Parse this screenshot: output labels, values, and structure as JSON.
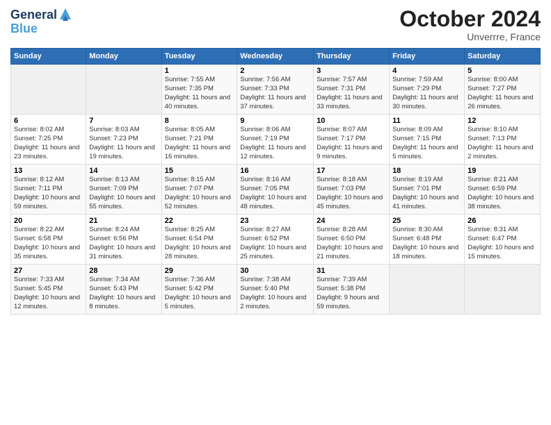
{
  "header": {
    "logo_line1": "General",
    "logo_line2": "Blue",
    "month_title": "October 2024",
    "location": "Unverrre, France"
  },
  "weekdays": [
    "Sunday",
    "Monday",
    "Tuesday",
    "Wednesday",
    "Thursday",
    "Friday",
    "Saturday"
  ],
  "weeks": [
    [
      {
        "day": "",
        "sunrise": "",
        "sunset": "",
        "daylight": ""
      },
      {
        "day": "",
        "sunrise": "",
        "sunset": "",
        "daylight": ""
      },
      {
        "day": "1",
        "sunrise": "Sunrise: 7:55 AM",
        "sunset": "Sunset: 7:35 PM",
        "daylight": "Daylight: 11 hours and 40 minutes."
      },
      {
        "day": "2",
        "sunrise": "Sunrise: 7:56 AM",
        "sunset": "Sunset: 7:33 PM",
        "daylight": "Daylight: 11 hours and 37 minutes."
      },
      {
        "day": "3",
        "sunrise": "Sunrise: 7:57 AM",
        "sunset": "Sunset: 7:31 PM",
        "daylight": "Daylight: 11 hours and 33 minutes."
      },
      {
        "day": "4",
        "sunrise": "Sunrise: 7:59 AM",
        "sunset": "Sunset: 7:29 PM",
        "daylight": "Daylight: 11 hours and 30 minutes."
      },
      {
        "day": "5",
        "sunrise": "Sunrise: 8:00 AM",
        "sunset": "Sunset: 7:27 PM",
        "daylight": "Daylight: 11 hours and 26 minutes."
      }
    ],
    [
      {
        "day": "6",
        "sunrise": "Sunrise: 8:02 AM",
        "sunset": "Sunset: 7:25 PM",
        "daylight": "Daylight: 11 hours and 23 minutes."
      },
      {
        "day": "7",
        "sunrise": "Sunrise: 8:03 AM",
        "sunset": "Sunset: 7:23 PM",
        "daylight": "Daylight: 11 hours and 19 minutes."
      },
      {
        "day": "8",
        "sunrise": "Sunrise: 8:05 AM",
        "sunset": "Sunset: 7:21 PM",
        "daylight": "Daylight: 11 hours and 16 minutes."
      },
      {
        "day": "9",
        "sunrise": "Sunrise: 8:06 AM",
        "sunset": "Sunset: 7:19 PM",
        "daylight": "Daylight: 11 hours and 12 minutes."
      },
      {
        "day": "10",
        "sunrise": "Sunrise: 8:07 AM",
        "sunset": "Sunset: 7:17 PM",
        "daylight": "Daylight: 11 hours and 9 minutes."
      },
      {
        "day": "11",
        "sunrise": "Sunrise: 8:09 AM",
        "sunset": "Sunset: 7:15 PM",
        "daylight": "Daylight: 11 hours and 5 minutes."
      },
      {
        "day": "12",
        "sunrise": "Sunrise: 8:10 AM",
        "sunset": "Sunset: 7:13 PM",
        "daylight": "Daylight: 11 hours and 2 minutes."
      }
    ],
    [
      {
        "day": "13",
        "sunrise": "Sunrise: 8:12 AM",
        "sunset": "Sunset: 7:11 PM",
        "daylight": "Daylight: 10 hours and 59 minutes."
      },
      {
        "day": "14",
        "sunrise": "Sunrise: 8:13 AM",
        "sunset": "Sunset: 7:09 PM",
        "daylight": "Daylight: 10 hours and 55 minutes."
      },
      {
        "day": "15",
        "sunrise": "Sunrise: 8:15 AM",
        "sunset": "Sunset: 7:07 PM",
        "daylight": "Daylight: 10 hours and 52 minutes."
      },
      {
        "day": "16",
        "sunrise": "Sunrise: 8:16 AM",
        "sunset": "Sunset: 7:05 PM",
        "daylight": "Daylight: 10 hours and 48 minutes."
      },
      {
        "day": "17",
        "sunrise": "Sunrise: 8:18 AM",
        "sunset": "Sunset: 7:03 PM",
        "daylight": "Daylight: 10 hours and 45 minutes."
      },
      {
        "day": "18",
        "sunrise": "Sunrise: 8:19 AM",
        "sunset": "Sunset: 7:01 PM",
        "daylight": "Daylight: 10 hours and 41 minutes."
      },
      {
        "day": "19",
        "sunrise": "Sunrise: 8:21 AM",
        "sunset": "Sunset: 6:59 PM",
        "daylight": "Daylight: 10 hours and 38 minutes."
      }
    ],
    [
      {
        "day": "20",
        "sunrise": "Sunrise: 8:22 AM",
        "sunset": "Sunset: 6:58 PM",
        "daylight": "Daylight: 10 hours and 35 minutes."
      },
      {
        "day": "21",
        "sunrise": "Sunrise: 8:24 AM",
        "sunset": "Sunset: 6:56 PM",
        "daylight": "Daylight: 10 hours and 31 minutes."
      },
      {
        "day": "22",
        "sunrise": "Sunrise: 8:25 AM",
        "sunset": "Sunset: 6:54 PM",
        "daylight": "Daylight: 10 hours and 28 minutes."
      },
      {
        "day": "23",
        "sunrise": "Sunrise: 8:27 AM",
        "sunset": "Sunset: 6:52 PM",
        "daylight": "Daylight: 10 hours and 25 minutes."
      },
      {
        "day": "24",
        "sunrise": "Sunrise: 8:28 AM",
        "sunset": "Sunset: 6:50 PM",
        "daylight": "Daylight: 10 hours and 21 minutes."
      },
      {
        "day": "25",
        "sunrise": "Sunrise: 8:30 AM",
        "sunset": "Sunset: 6:48 PM",
        "daylight": "Daylight: 10 hours and 18 minutes."
      },
      {
        "day": "26",
        "sunrise": "Sunrise: 8:31 AM",
        "sunset": "Sunset: 6:47 PM",
        "daylight": "Daylight: 10 hours and 15 minutes."
      }
    ],
    [
      {
        "day": "27",
        "sunrise": "Sunrise: 7:33 AM",
        "sunset": "Sunset: 5:45 PM",
        "daylight": "Daylight: 10 hours and 12 minutes."
      },
      {
        "day": "28",
        "sunrise": "Sunrise: 7:34 AM",
        "sunset": "Sunset: 5:43 PM",
        "daylight": "Daylight: 10 hours and 8 minutes."
      },
      {
        "day": "29",
        "sunrise": "Sunrise: 7:36 AM",
        "sunset": "Sunset: 5:42 PM",
        "daylight": "Daylight: 10 hours and 5 minutes."
      },
      {
        "day": "30",
        "sunrise": "Sunrise: 7:38 AM",
        "sunset": "Sunset: 5:40 PM",
        "daylight": "Daylight: 10 hours and 2 minutes."
      },
      {
        "day": "31",
        "sunrise": "Sunrise: 7:39 AM",
        "sunset": "Sunset: 5:38 PM",
        "daylight": "Daylight: 9 hours and 59 minutes."
      },
      {
        "day": "",
        "sunrise": "",
        "sunset": "",
        "daylight": ""
      },
      {
        "day": "",
        "sunrise": "",
        "sunset": "",
        "daylight": ""
      }
    ]
  ]
}
